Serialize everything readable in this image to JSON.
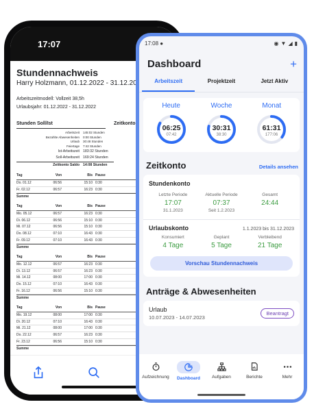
{
  "back_phone": {
    "status_time": "17:07",
    "title": "Stundennachweis",
    "subtitle": "Harry Holzmann, 01.12.2022 - 31.12.2022",
    "meta_line1": "Arbeitszeitmodell: Vollzeit 38,5h",
    "meta_line2": "Urlaubsjahr: 01.12.2022 - 31.12.2022",
    "section_left": "Stunden Soll/Ist",
    "section_right": "Zeitkonto",
    "soll_rows": [
      {
        "label": "Arbeitszeit",
        "value": "145:02 Stunden"
      },
      {
        "label": "Bezahlte Abwesenheiten",
        "value": "0:00 Stunden"
      },
      {
        "label": "Urlaub",
        "value": "30:48 Stunden"
      },
      {
        "label": "Feiertage",
        "value": "7:42 Stunden"
      }
    ],
    "ist_label": "Ist-Arbeitszeit",
    "ist_value": "183:32 Stunden",
    "soll_label": "Soll-Arbeitszeit",
    "soll_value": "169:24 Stunden",
    "saldo_label": "Zeitkonto Saldo",
    "saldo_value": "14:08 Stunden",
    "columns": [
      "Tag",
      "Von",
      "Bis",
      "Pause"
    ],
    "sum_label": "Summe",
    "weeks": [
      [
        [
          "Do.",
          "01.12",
          "06:56",
          "15:10",
          "0:30"
        ],
        [
          "Fr.",
          "02.12",
          "06:57",
          "16:23",
          "0:30"
        ]
      ],
      [
        [
          "Mo.",
          "05.12",
          "06:57",
          "16:23",
          "0:30"
        ],
        [
          "Di.",
          "06.12",
          "06:56",
          "15:10",
          "0:30"
        ],
        [
          "Mi.",
          "07.12",
          "06:56",
          "15:10",
          "0:30"
        ],
        [
          "Do.",
          "08.12",
          "07:10",
          "16:43",
          "0:30"
        ],
        [
          "Fr.",
          "09.12",
          "07:10",
          "16:43",
          "0:30"
        ]
      ],
      [
        [
          "Mo.",
          "12.12",
          "06:57",
          "16:23",
          "0:30"
        ],
        [
          "Di.",
          "13.12",
          "06:57",
          "16:23",
          "0:30"
        ],
        [
          "Mi.",
          "14.12",
          "08:00",
          "17:00",
          "0:30"
        ],
        [
          "Do.",
          "15.12",
          "07:10",
          "16:43",
          "0:30"
        ],
        [
          "Fr.",
          "16.12",
          "06:56",
          "15:10",
          "0:30"
        ]
      ],
      [
        [
          "Mo.",
          "19.12",
          "08:00",
          "17:00",
          "0:30"
        ],
        [
          "Di.",
          "20.12",
          "07:10",
          "16:43",
          "0:30"
        ],
        [
          "Mi.",
          "21.12",
          "08:00",
          "17:00",
          "0:30"
        ],
        [
          "Do.",
          "22.12",
          "06:57",
          "16:23",
          "0:30"
        ],
        [
          "Fr.",
          "23.12",
          "06:56",
          "15:10",
          "0:30"
        ]
      ]
    ],
    "toolbar_icons": [
      "share-icon",
      "search-icon",
      "markup-icon"
    ]
  },
  "front_phone": {
    "status_time": "17:08",
    "title": "Dashboard",
    "add_symbol": "+",
    "tabs": [
      "Arbeitszeit",
      "Projektzeit",
      "Jetzt Aktiv"
    ],
    "active_tab": 0,
    "gauges": [
      {
        "label": "Heute",
        "value": "06:25",
        "target": "07:42",
        "fraction": 0.83
      },
      {
        "label": "Woche",
        "value": "30:31",
        "target": "38:30",
        "fraction": 0.79
      },
      {
        "label": "Monat",
        "value": "61:31",
        "target": "177:06",
        "fraction": 0.35
      }
    ],
    "zeitkonto_title": "Zeitkonto",
    "details_link": "Details ansehen",
    "stundenkonto": {
      "title": "Stundenkonto",
      "cols": [
        {
          "label": "Letzte Periode",
          "value": "17:07",
          "sub": "31.1.2023"
        },
        {
          "label": "Aktuelle Periode",
          "value": "07:37",
          "sub": "Seit 1.2.2023"
        },
        {
          "label": "Gesamt",
          "value": "24:44",
          "sub": ""
        }
      ]
    },
    "urlaubskonto": {
      "title": "Urlaubskonto",
      "range": "1.1.2023 bis 31.12.2023",
      "cols": [
        {
          "label": "Konsumiert",
          "value": "4 Tage"
        },
        {
          "label": "Geplant",
          "value": "5 Tage"
        },
        {
          "label": "Verbleibend",
          "value": "21 Tage"
        }
      ]
    },
    "preview_button": "Vorschau Stundennachweis",
    "antraege_title": "Anträge & Abwesenheiten",
    "request": {
      "type": "Urlaub",
      "dates": "10.07.2023 - 14.07.2023",
      "status": "Beantragt"
    },
    "nav": [
      {
        "label": "Aufzeichnung",
        "icon": "stopwatch-icon"
      },
      {
        "label": "Dashboard",
        "icon": "pie-chart-icon"
      },
      {
        "label": "Aufgaben",
        "icon": "hierarchy-icon"
      },
      {
        "label": "Berichte",
        "icon": "report-icon"
      },
      {
        "label": "Mehr",
        "icon": "more-icon"
      }
    ],
    "active_nav": 1,
    "colors": {
      "accent": "#2d6cf3",
      "positive": "#3b9b40",
      "frame": "#5f8bea",
      "badge": "#7c4cc2"
    }
  }
}
